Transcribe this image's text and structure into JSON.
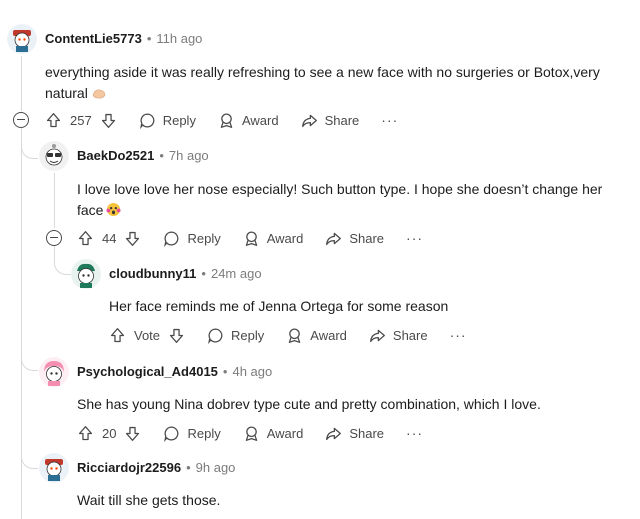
{
  "comments": [
    {
      "username": "ContentLie5773",
      "time": "11h ago",
      "text": "everything aside it was really refreshing to see a new face with no surgeries or Botox,very natural",
      "emoji": "palm-hand",
      "votes": "257",
      "reply": "Reply",
      "award": "Award",
      "share": "Share",
      "more": "···"
    },
    {
      "username": "BaekDo2521",
      "time": "7h ago",
      "text": "I love love love her nose especially! Such button type. I hope she doesn’t change her face",
      "emoji": "shocked-face",
      "votes": "44",
      "reply": "Reply",
      "award": "Award",
      "share": "Share",
      "more": "···"
    },
    {
      "username": "cloudbunny11",
      "time": "24m ago",
      "text": "Her face reminds me of Jenna Ortega for some reason",
      "votes": "Vote",
      "reply": "Reply",
      "award": "Award",
      "share": "Share",
      "more": "···"
    },
    {
      "username": "Psychological_Ad4015",
      "time": "4h ago",
      "text": "She has young Nina dobrev type cute and pretty combination, which I love.",
      "votes": "20",
      "reply": "Reply",
      "award": "Award",
      "share": "Share",
      "more": "···"
    },
    {
      "username": "Ricciardojr22596",
      "time": "9h ago",
      "text": "Wait till she gets those."
    }
  ],
  "separator": "•",
  "colors": {
    "text": "#1c1c1c",
    "meta": "#7c7c7c",
    "thread": "#d7d9db",
    "snoo_orange": "#ff4500"
  }
}
